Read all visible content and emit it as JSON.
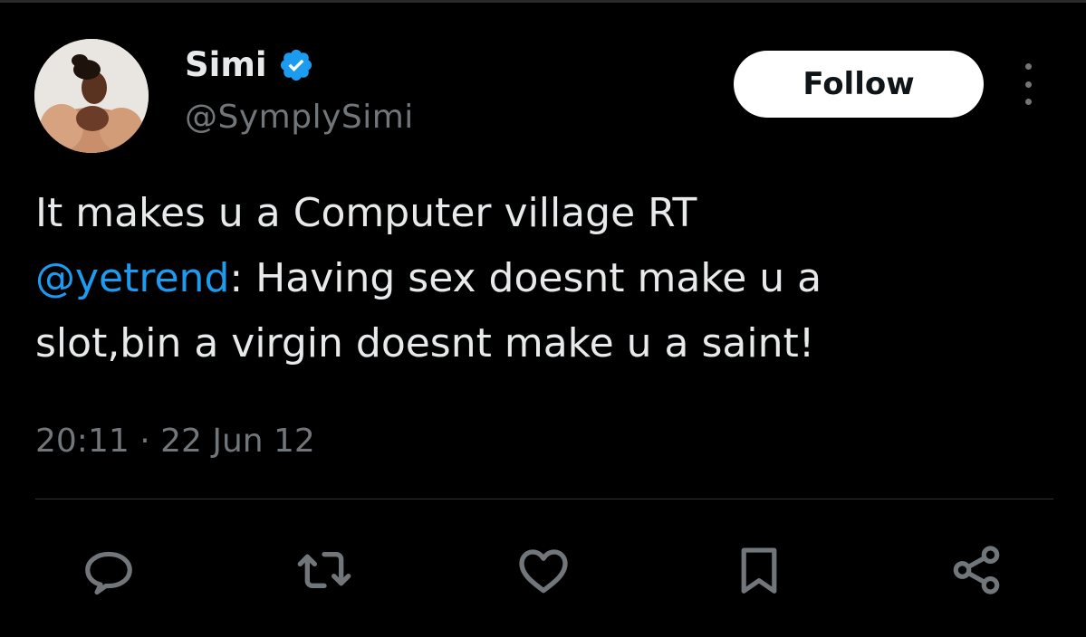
{
  "tweet": {
    "author": {
      "display_name": "Simi",
      "handle": "@SymplySimi",
      "verified": true
    },
    "follow_label": "Follow",
    "text_before_mention": "It makes u a Computer village RT\n",
    "mention": "@yetrend",
    "text_after_mention": ": Having sex doesnt make u a\nslot,bin a virgin doesnt make u a saint!",
    "timestamp": "20:11 · 22 Jun 12"
  },
  "actions": [
    "reply-icon",
    "retweet-icon",
    "like-icon",
    "bookmark-icon",
    "share-icon"
  ],
  "colors": {
    "background": "#000000",
    "text": "#e7e9ea",
    "secondary_text": "#71767b",
    "link": "#1d9bf0",
    "verified_badge": "#1d9bf0",
    "divider": "#2f3336",
    "follow_button_bg": "#ffffff",
    "follow_button_text": "#0f1419"
  }
}
